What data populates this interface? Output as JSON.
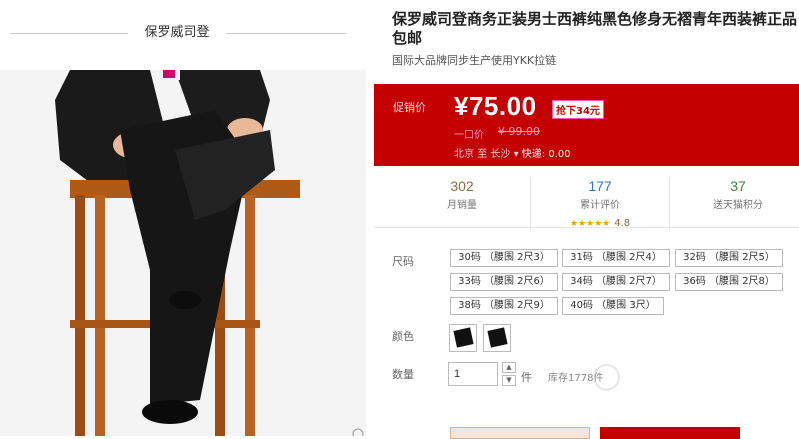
{
  "brand": {
    "name": "保罗威司登"
  },
  "product": {
    "title": "保罗威司登商务正装男士西裤纯黑色修身无褶青年西装裤正品包邮",
    "subtitle": "国际大品牌同步生产使用YKK拉链"
  },
  "price": {
    "label": "促销价",
    "current": "¥75.00",
    "discount_badge": "抢下34元",
    "original_label": "一口价",
    "original_value": "¥ 99.00"
  },
  "shipping": {
    "from": "北京",
    "to_label": "至",
    "to": "长沙",
    "method": "快递: 0.00"
  },
  "stats": {
    "monthly_sales": {
      "value": "302",
      "label": "月销量"
    },
    "reviews": {
      "value": "177",
      "label": "累计评价",
      "stars": "★★★★★",
      "rating": "4.8"
    },
    "points": {
      "value": "37",
      "label": "送天猫积分"
    }
  },
  "options": {
    "size_label": "尺码",
    "sizes": [
      "30码 （腰围 2尺3）",
      "31码 （腰围 2尺4）",
      "32码 （腰围 2尺5）",
      "33码 （腰围 2尺6）",
      "34码 （腰围 2尺7）",
      "36码 （腰围 2尺8）",
      "38码 （腰围 2尺9）",
      "40码 （腰围 3尺）"
    ],
    "color_label": "颜色",
    "quantity_label": "数量",
    "quantity_value": "1",
    "unit": "件",
    "stock": "库存1778件"
  },
  "colors": {
    "accent": "#c40000",
    "text": "#333333"
  }
}
